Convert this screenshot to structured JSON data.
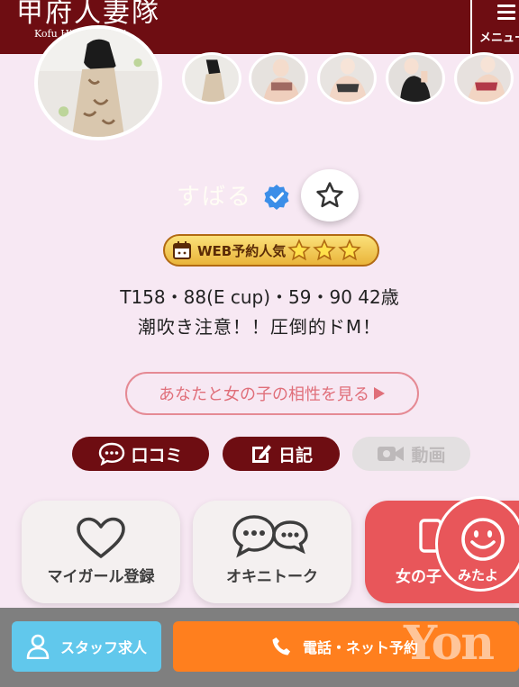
{
  "header": {
    "logo_main": "甲府人妻隊",
    "logo_sub": "Kofu Hitoduma tai",
    "menu_label": "メニュー"
  },
  "profile": {
    "name": "すばる",
    "badge_label": "WEB予約人気",
    "badge_stars": 3,
    "specs": "T158・88(E cup)・59・90 42歳",
    "catchphrase": "潮吹き注意！！圧倒的ドM！"
  },
  "actions": {
    "compatibility": "あなたと女の子の相性を見る",
    "reviews": "口コミ",
    "diary": "日記",
    "video": "動画"
  },
  "cards": {
    "my_girl": "マイガール登録",
    "okini_talk": "オキニトーク",
    "third": "女の子",
    "mitayo": "みたよ"
  },
  "bottom": {
    "staff": "スタッフ求人",
    "phone": "電話・ネット予約",
    "watermark": "Yon"
  },
  "colors": {
    "header_bg": "#6e0d12",
    "page_bg": "#f7e8f3",
    "accent_red": "#e8565a",
    "staff_blue": "#61c8ec",
    "phone_orange": "#ff7f1e",
    "verified_blue": "#3b8ee8"
  },
  "icons": {
    "fav": "star-outline-icon",
    "verified": "verified-badge-icon",
    "reviews": "speech-bubble-icon",
    "diary": "edit-icon",
    "video": "video-camera-icon",
    "my_girl": "heart-icon",
    "okini_talk": "chat-bubbles-icon",
    "mitayo": "smiley-icon",
    "staff": "person-icon",
    "phone": "phone-icon"
  }
}
